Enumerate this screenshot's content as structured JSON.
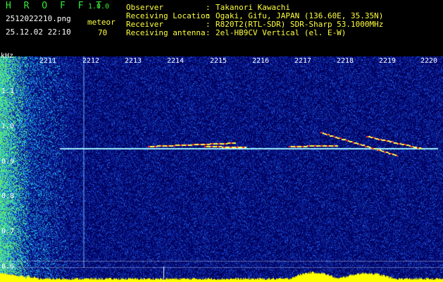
{
  "header": {
    "app_name": "H R O F F T",
    "app_version": "1.0.0",
    "filename": "2512022210.png",
    "timestamp": "25.12.02 22:10",
    "meteor_label": "meteor",
    "meteor_count": "70"
  },
  "info": [
    {
      "key": "Observer",
      "sep": ":",
      "value": "Takanori Kawachi"
    },
    {
      "key": "Receiving Location",
      "sep": ":",
      "value": "Ogaki, Gifu, JAPAN (136.60E, 35.35N)"
    },
    {
      "key": "Receiver",
      "sep": ":",
      "value": "R820T2(RTL-SDR) SDR-Sharp 53.1000MHz"
    },
    {
      "key": "Receiving antenna",
      "sep": ":",
      "value": "2el-HB9CV Vertical (el. E-W)"
    }
  ],
  "spectrogram": {
    "y_unit": "kHz",
    "time_ticks": [
      "2211",
      "2212",
      "2213",
      "2214",
      "2215",
      "2216",
      "2217",
      "2218",
      "2219",
      "2220"
    ],
    "freq_ticks": [
      "1.1",
      "1.0",
      "0.9",
      "0.8",
      "0.7",
      "0.6"
    ],
    "y_range": [
      0.58,
      1.18
    ],
    "x_range": [
      2210.6,
      2220
    ],
    "carrier_khz": 0.925,
    "colors": {
      "background": "#00005a",
      "noise": "#1a2ab0",
      "grid": "#ffffff",
      "power_bar": "#ffff00",
      "carrier": "#9cf0ff"
    }
  }
}
